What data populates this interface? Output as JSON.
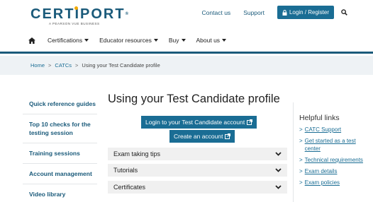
{
  "brand": {
    "name": "CERTIPORT",
    "tm": "®",
    "subtitle": "A PEARSON VUE BUSINESS",
    "accent": "#1a5a7a",
    "dot": "#f2a900"
  },
  "top_links": {
    "contact": "Contact us",
    "support": "Support",
    "login": "Login / Register"
  },
  "nav": {
    "items": [
      "Certifications",
      "Educator resources",
      "Buy",
      "About us"
    ]
  },
  "breadcrumb": {
    "home": "Home",
    "catcs": "CATCs",
    "sep": ">",
    "current": "Using your Test Candidate profile"
  },
  "sidebar": {
    "items": [
      "Quick reference guides",
      "Top 10 checks for the testing session",
      "Training sessions",
      "Account management",
      "Video library"
    ]
  },
  "main": {
    "title": "Using your Test Candidate profile",
    "login_button": "Login to your Test Candidate account",
    "create_button": "Create an account",
    "accordion": [
      "Exam taking tips",
      "Tutorials",
      "Certificates"
    ]
  },
  "aside": {
    "title": "Helpful links",
    "arrow": ">",
    "links": [
      "CATC Support",
      "Get started as a test center",
      "Technical requirements",
      "Exam details",
      "Exam policies"
    ]
  }
}
